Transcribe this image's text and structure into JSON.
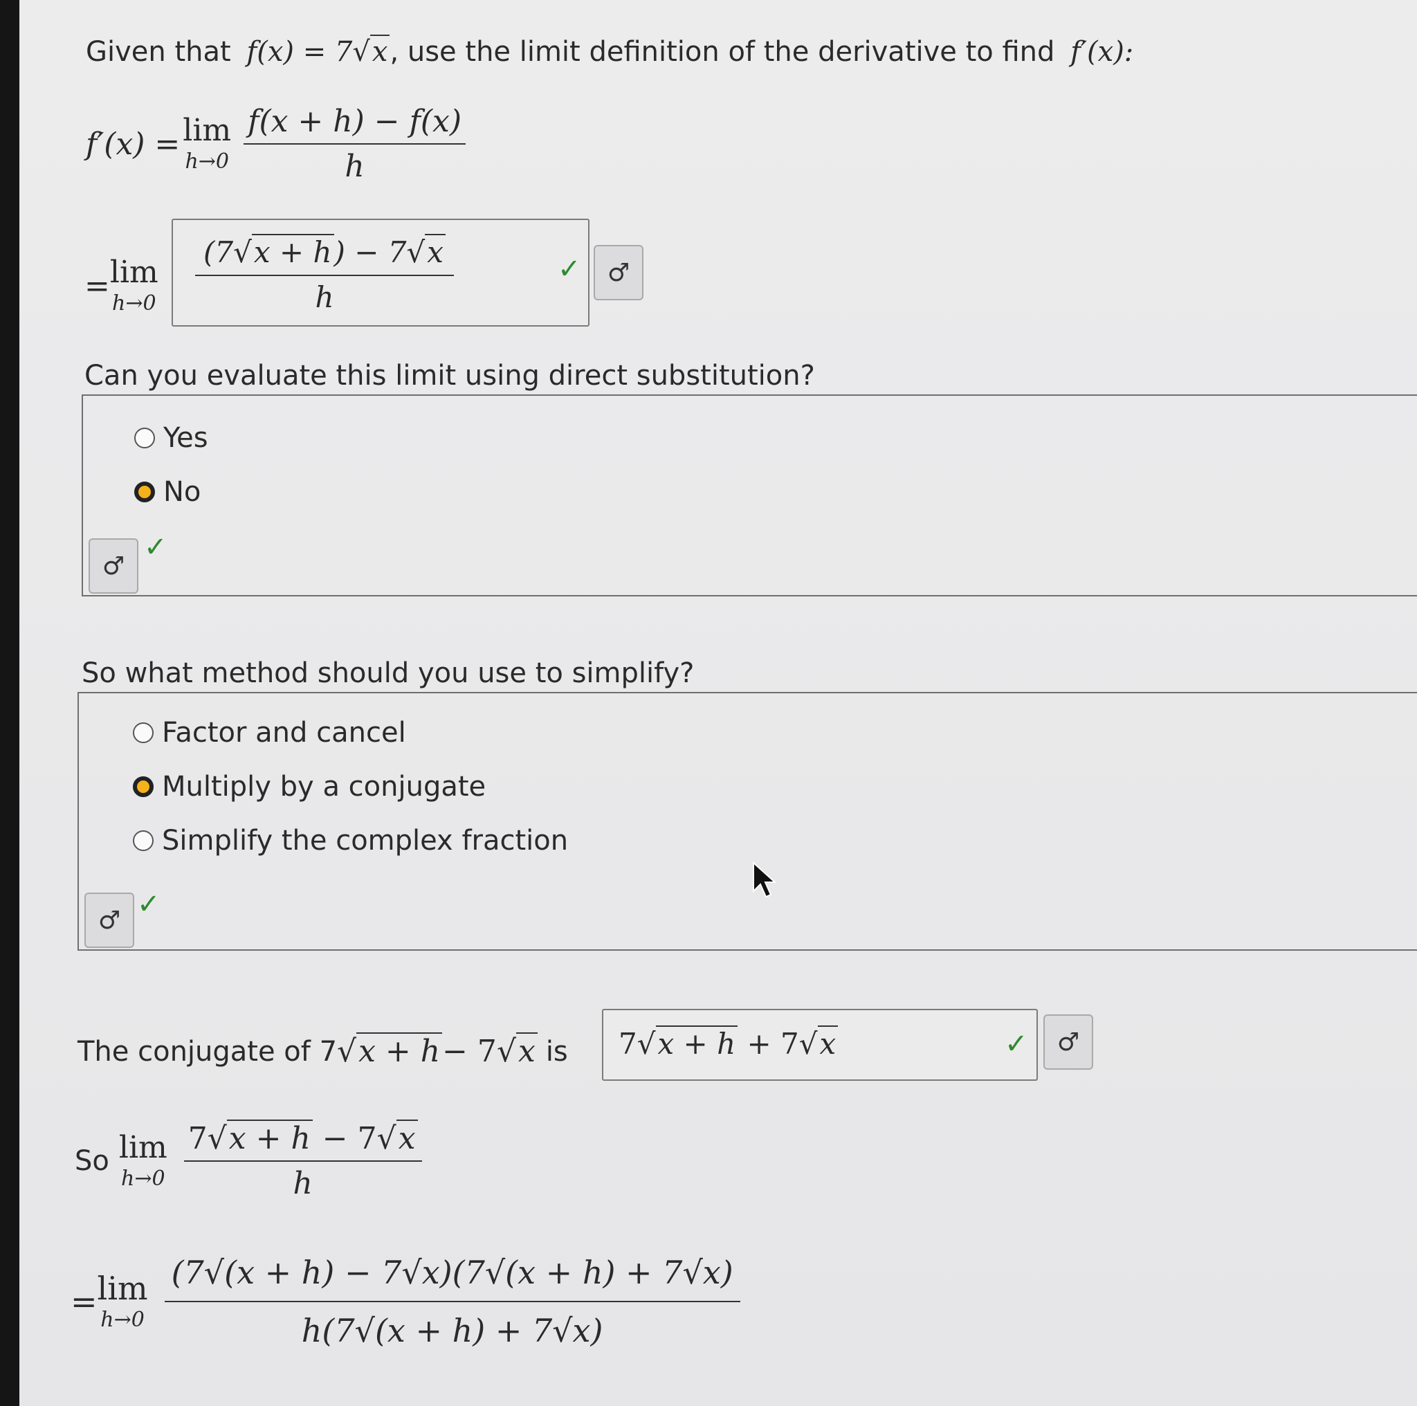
{
  "intro": {
    "text": "Given that",
    "fx": "f(x) = 7",
    "sqrt_arg": "x",
    "rest": ", use the limit definition of the derivative to find",
    "target": "f′(x):"
  },
  "definition": {
    "lhs": "f′(x) =",
    "lim": "lim",
    "lim_sub": "h→0",
    "numerator": "f(x + h) − f(x)",
    "denominator": "h"
  },
  "answer1": {
    "prefix": "=",
    "lim": "lim",
    "lim_sub": "h→0",
    "num_a": "(7",
    "num_a_sqrt": "x + h",
    "num_b": ") − 7",
    "num_b_sqrt": "x",
    "denominator": "h",
    "status": "✓",
    "key_icon": "♂"
  },
  "question1": {
    "prompt": "Can you evaluate this limit using direct substitution?",
    "options": [
      "Yes",
      "No"
    ],
    "selected": "No",
    "status": "✓",
    "key_icon": "♂"
  },
  "question2": {
    "prompt": "So what method should you use to simplify?",
    "options": [
      "Factor and cancel",
      "Multiply by a conjugate",
      "Simplify the complex fraction"
    ],
    "selected": "Multiply by a conjugate",
    "status": "✓",
    "key_icon": "♂"
  },
  "conjugate": {
    "prefix": "The conjugate of 7",
    "sqrt1": "x + h",
    "middle": " − 7",
    "sqrt2": "x",
    "is": "is",
    "answer_a": "7",
    "answer_sqrt1": "x + h",
    "answer_b": " + 7",
    "answer_sqrt2": "x",
    "status": "✓",
    "key_icon": "♂"
  },
  "step_so": {
    "so": "So",
    "lim": "lim",
    "lim_sub": "h→0",
    "num_a": "7",
    "num_sqrt1": "x + h",
    "num_mid": " − 7",
    "num_sqrt2": "x",
    "denominator": "h"
  },
  "step_expand": {
    "prefix": "=",
    "lim": "lim",
    "lim_sub": "h→0",
    "numerator": "(7√(x + h) − 7√x)(7√(x + h) + 7√x)",
    "denominator": "h(7√(x + h) + 7√x)"
  },
  "colors": {
    "selected_radio": "#f6b21b",
    "check": "#2e8b2e"
  }
}
